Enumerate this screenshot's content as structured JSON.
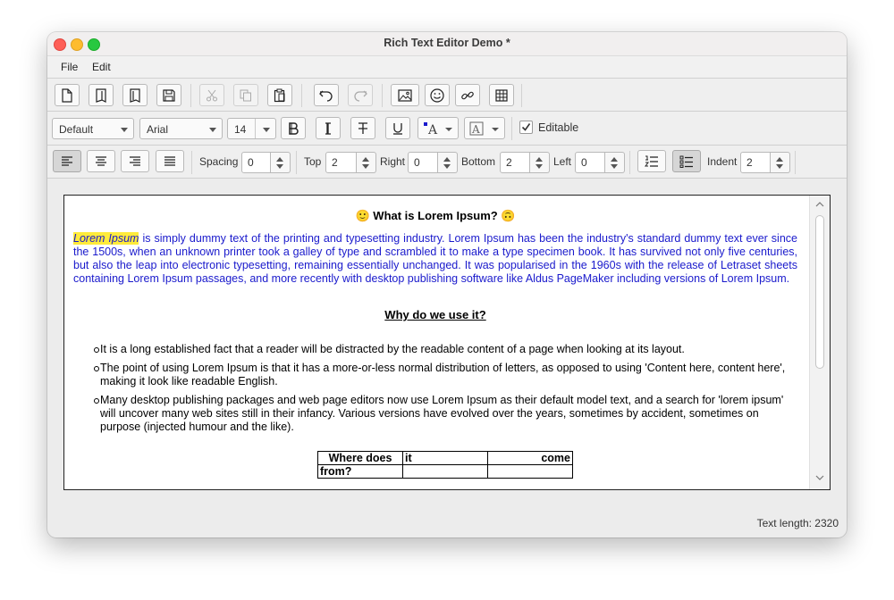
{
  "window": {
    "title": "Rich Text Editor Demo *"
  },
  "menu": {
    "file": "File",
    "edit": "Edit"
  },
  "toolbar": {
    "file_buttons": [
      "new-document-icon",
      "open-icon",
      "open-file-icon",
      "save-icon"
    ],
    "edit_buttons": [
      "cut-icon",
      "copy-icon",
      "paste-icon"
    ],
    "history_buttons": [
      "undo-icon",
      "redo-icon"
    ],
    "insert_buttons": [
      "image-icon",
      "emoji-icon",
      "link-icon",
      "table-icon"
    ]
  },
  "format": {
    "style": "Default",
    "font": "Arial",
    "size": "14",
    "editable_label": "Editable",
    "editable_checked": true
  },
  "paragraph": {
    "spacing_label": "Spacing",
    "spacing": "0",
    "top_label": "Top",
    "top": "2",
    "right_label": "Right",
    "right": "0",
    "bottom_label": "Bottom",
    "bottom": "2",
    "left_label": "Left",
    "left": "0",
    "indent_label": "Indent",
    "indent": "2"
  },
  "document": {
    "title_emoji_left": "🙂",
    "title": "What is Lorem Ipsum?",
    "title_emoji_right": "🙃",
    "highlight": "Lorem Ipsum",
    "paragraph": " is simply dummy text of the printing and typesetting industry. Lorem Ipsum has been the industry's standard dummy text ever since the 1500s, when an unknown printer took a galley of type and scrambled it to make a type specimen book. It has survived not only five centuries, but also the leap into electronic typesetting, remaining essentially unchanged. It was popularised in the 1960s with the release of Letraset sheets containing Lorem Ipsum passages, and more recently with desktop publishing software like Aldus PageMaker including versions of Lorem Ipsum.",
    "subtitle": "Why do we use it?",
    "bullets": [
      "It is a long established fact that a reader will be distracted by the readable content of a page when looking at its layout.",
      "The point of using Lorem Ipsum is that it has a more-or-less normal distribution of letters, as opposed to using 'Content here, content here', making it look like readable English.",
      "Many desktop publishing packages and web page editors now use Lorem Ipsum as their default model text, and a search for 'lorem ipsum' will uncover many web sites still in their infancy. Various versions have evolved over the years, sometimes by accident, sometimes on purpose (injected humour and the like)."
    ],
    "table": {
      "r1c1": "Where does",
      "r1c2": "it",
      "r1c3": "come",
      "r2c1": "from?",
      "r2c2": "",
      "r2c3": ""
    }
  },
  "status": {
    "text_length": "Text length: 2320"
  }
}
